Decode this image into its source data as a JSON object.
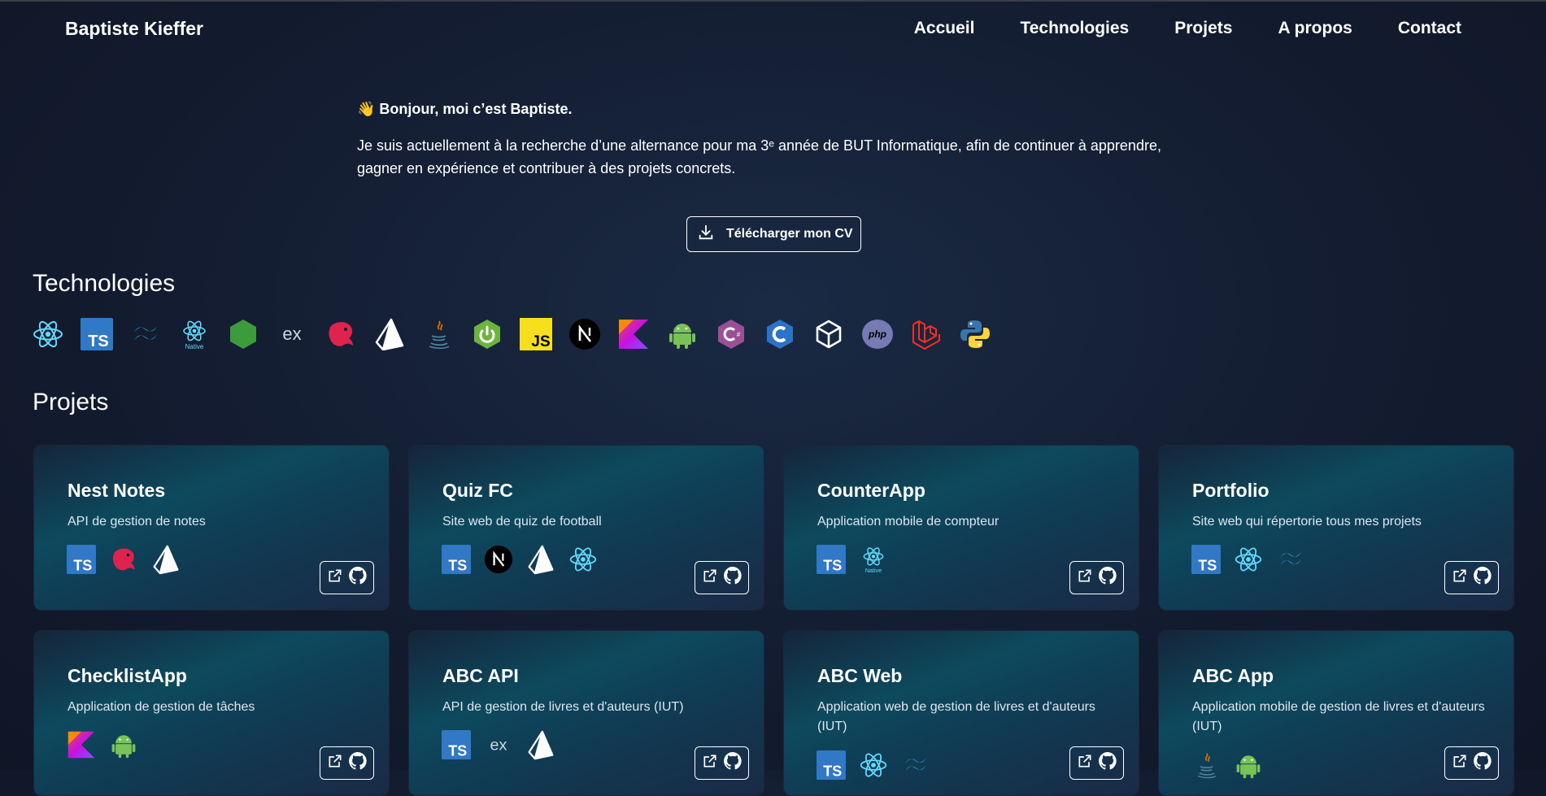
{
  "header": {
    "brand": "Baptiste Kieffer",
    "nav": [
      "Accueil",
      "Technologies",
      "Projets",
      "A propos",
      "Contact"
    ]
  },
  "intro": {
    "greeting": "👋 Bonjour, moi c’est Baptiste.",
    "description": "Je suis actuellement à la recherche d’une alternance pour ma 3ᵉ année de BUT Informatique, afin de continuer à apprendre, gagner en expérience et contribuer à des projets concrets.",
    "cv_button": "Télécharger mon CV"
  },
  "technologies": {
    "title": "Technologies",
    "icons": [
      "react-icon",
      "typescript-icon",
      "tailwind-icon",
      "react-native-icon",
      "nodejs-icon",
      "express-icon",
      "nestjs-icon",
      "prisma-icon",
      "java-icon",
      "spring-boot-icon",
      "javascript-icon",
      "nextjs-icon",
      "kotlin-icon",
      "android-icon",
      "csharp-icon",
      "c-icon",
      "unity-icon",
      "php-icon",
      "laravel-icon",
      "python-icon"
    ]
  },
  "projects": {
    "title": "Projets",
    "items": [
      {
        "name": "Nest Notes",
        "description": "API de gestion de notes",
        "stack": [
          "typescript-icon",
          "nestjs-icon",
          "prisma-icon"
        ]
      },
      {
        "name": "Quiz FC",
        "description": "Site web de quiz de football",
        "stack": [
          "typescript-icon",
          "nextjs-icon",
          "prisma-icon",
          "react-icon"
        ]
      },
      {
        "name": "CounterApp",
        "description": "Application mobile de compteur",
        "stack": [
          "typescript-icon",
          "react-native-icon"
        ]
      },
      {
        "name": "Portfolio",
        "description": "Site web qui répertorie tous mes projets",
        "stack": [
          "typescript-icon",
          "react-icon",
          "tailwind-icon"
        ]
      },
      {
        "name": "ChecklistApp",
        "description": "Application de gestion de tâches",
        "stack": [
          "kotlin-icon",
          "android-icon"
        ]
      },
      {
        "name": "ABC API",
        "description": "API de gestion de livres et d'auteurs (IUT)",
        "stack": [
          "typescript-icon",
          "express-icon",
          "prisma-icon"
        ]
      },
      {
        "name": "ABC Web",
        "description": "Application web de gestion de livres et d'auteurs (IUT)",
        "stack": [
          "typescript-icon",
          "react-icon",
          "tailwind-icon"
        ]
      },
      {
        "name": "ABC App",
        "description": "Application mobile de gestion de livres et d'auteurs (IUT)",
        "stack": [
          "java-icon",
          "android-icon"
        ]
      }
    ]
  },
  "colors": {
    "accent_border": "#ffffff",
    "card_teal": "#0d4a5e",
    "background": "#131c30"
  }
}
